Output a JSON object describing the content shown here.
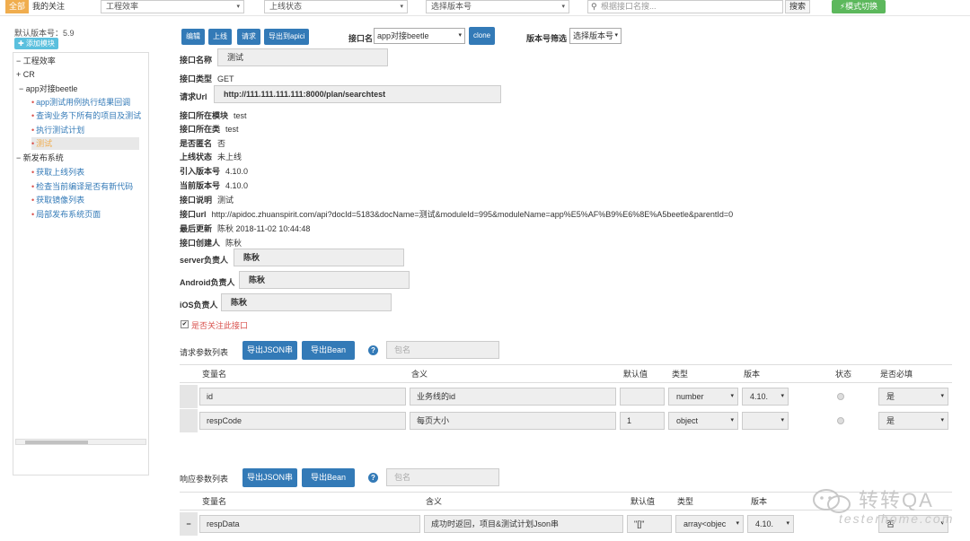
{
  "topbar": {
    "tab_all": "全部",
    "tab_mine": "我的关注",
    "select_project": "工程效率",
    "select_online_status": "上线状态",
    "select_version": "选择版本号",
    "search_placeholder": "根据接口名搜...",
    "search_button": "搜索",
    "mode_switch_button": "模式切换"
  },
  "sidebar": {
    "default_version": "默认版本号：5.9",
    "add_module_button": "添加模块",
    "tree": [
      {
        "type": "group",
        "label": "工程效率",
        "sign": "−"
      },
      {
        "type": "group",
        "label": "CR",
        "sign": "+"
      },
      {
        "type": "group",
        "label": "app对接beetle",
        "sign": "−"
      },
      {
        "type": "leaf",
        "label": "app测试用例执行结果回调"
      },
      {
        "type": "leaf",
        "label": "查询业务下所有的项目及测试"
      },
      {
        "type": "leaf",
        "label": "执行测试计划"
      },
      {
        "type": "leaf",
        "label": "测试",
        "selected": true
      },
      {
        "type": "group",
        "label": "新发布系统",
        "sign": "−"
      },
      {
        "type": "leaf",
        "label": "获取上线列表"
      },
      {
        "type": "leaf",
        "label": "检查当前编译是否有新代码"
      },
      {
        "type": "leaf",
        "label": "获取镜像列表"
      },
      {
        "type": "leaf",
        "label": "局部发布系统页面"
      }
    ]
  },
  "toolbar": {
    "edit_button": "编辑",
    "online_button": "上线",
    "request_button": "请求",
    "export_apici_button": "导出到apici",
    "api_name_label": "接口名",
    "api_name_select": "app对接beetle",
    "clone_button": "clone",
    "version_filter_label": "版本号筛选",
    "version_filter_select": "选择版本号"
  },
  "details": {
    "name_label": "接口名称",
    "name_value": "测试",
    "type_label": "接口类型",
    "type_value": "GET",
    "url_label": "请求Url",
    "url_value": "http://111.111.111.111:8000/plan/searchtest",
    "module_label": "接口所在模块",
    "module_value": "test",
    "class_label": "接口所在类",
    "class_value": "test",
    "anonymous_label": "是否匿名",
    "anonymous_value": "否",
    "online_label": "上线状态",
    "online_value": "未上线",
    "intro_version_label": "引入版本号",
    "intro_version_value": "4.10.0",
    "current_version_label": "当前版本号",
    "current_version_value": "4.10.0",
    "desc_label": "接口说明",
    "desc_value": "测试",
    "apiurl_label": "接口url",
    "apiurl_value": "http://apidoc.zhuanspirit.com/api?docId=5183&docName=测试&moduleId=995&moduleName=app%E5%AF%B9%E6%8E%A5beetle&parentId=0",
    "updated_label": "最后更新",
    "updated_value": "陈秋  2018-11-02 10:44:48",
    "creator_label": "接口创建人",
    "creator_value": "陈秋",
    "server_owner_label": "server负责人",
    "server_owner_value": "陈秋",
    "android_owner_label": "Android负责人",
    "android_owner_value": "陈秋",
    "ios_owner_label": "iOS负责人",
    "ios_owner_value": "陈秋",
    "follow_label": "是否关注此接口"
  },
  "request_params": {
    "title": "请求参数列表",
    "export_json_button": "导出JSON串",
    "export_bean_button": "导出Bean",
    "help_icon_text": "?",
    "package_placeholder": "包名",
    "headers": [
      "变量名",
      "含义",
      "默认值",
      "类型",
      "版本",
      "状态",
      "是否必填"
    ],
    "rows": [
      {
        "name": "id",
        "meaning": "业务线的id",
        "default": "",
        "type": "number",
        "version": "4.10.",
        "required": "是"
      },
      {
        "name": "respCode",
        "meaning": "每页大小",
        "default": "1",
        "type": "object",
        "version": "",
        "required": "是"
      }
    ]
  },
  "response_params": {
    "title": "响应参数列表",
    "export_json_button": "导出JSON串",
    "export_bean_button": "导出Bean",
    "help_icon_text": "?",
    "package_placeholder": "包名",
    "headers": [
      "变量名",
      "含义",
      "默认值",
      "类型",
      "版本"
    ],
    "rows": [
      {
        "handle": "−",
        "name": "respData",
        "meaning": "成功时返回，项目&测试计划Json串",
        "default": "\"[]\"",
        "type": "array<objec",
        "version": "4.10.",
        "required": "否"
      }
    ]
  },
  "watermark": {
    "title": "转转QA",
    "subtitle": "testerhome.com"
  },
  "colors": {
    "primary": "#337ab7",
    "success": "#5cb85c",
    "warning": "#f0ad4e",
    "info": "#5bc0de",
    "danger": "#d9534f"
  }
}
